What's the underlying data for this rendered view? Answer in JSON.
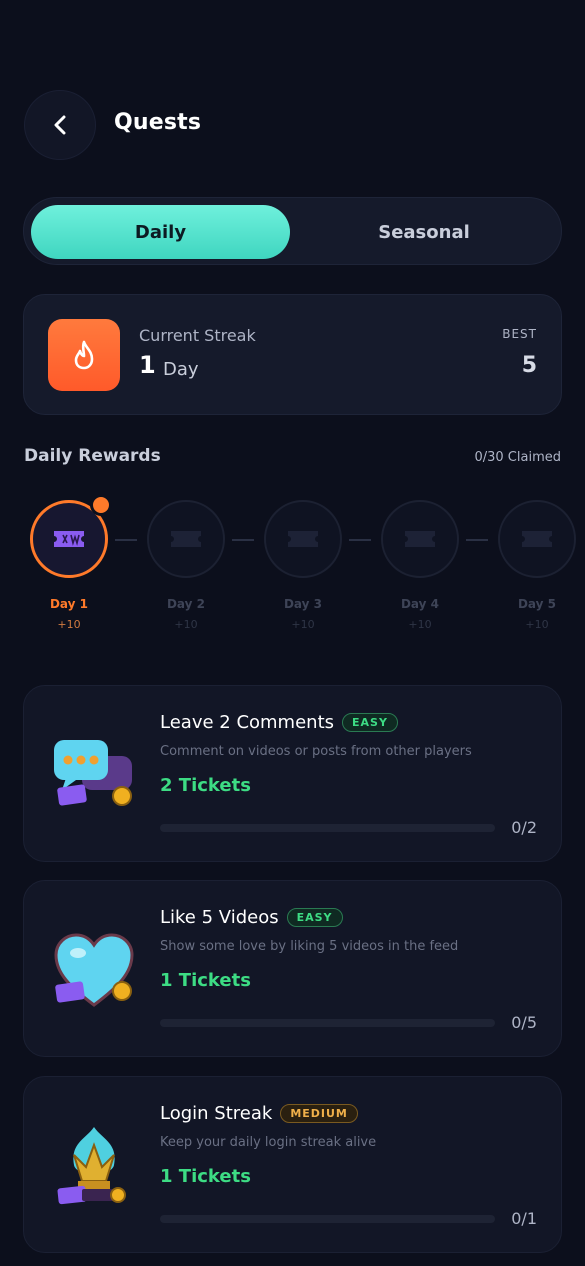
{
  "header": {
    "title": "Quests"
  },
  "tabs": [
    {
      "label": "Daily",
      "active": true
    },
    {
      "label": "Seasonal",
      "active": false
    }
  ],
  "streak": {
    "label": "Current Streak",
    "value": "1",
    "unit": "Day",
    "best_label": "BEST",
    "best_value": "5",
    "icon": "flame-icon",
    "color": "#ff6a30"
  },
  "rewards": {
    "title": "Daily Rewards",
    "claimed": "0/30 Claimed",
    "days": [
      {
        "label": "Day 1",
        "reward": "+10",
        "active": true
      },
      {
        "label": "Day 2",
        "reward": "+10",
        "active": false
      },
      {
        "label": "Day 3",
        "reward": "+10",
        "active": false
      },
      {
        "label": "Day 4",
        "reward": "+10",
        "active": false
      },
      {
        "label": "Day 5",
        "reward": "+10",
        "active": false
      }
    ],
    "icon": "ticket-icon",
    "accent": "#ff7a2a"
  },
  "quests": [
    {
      "title": "Leave 2 Comments",
      "difficulty": "EASY",
      "description": "Comment on videos or posts from other players",
      "reward": "2 Tickets",
      "progress": "0/2",
      "progress_fraction": 0,
      "icon": "chat-bubble-icon"
    },
    {
      "title": "Like 5 Videos",
      "difficulty": "EASY",
      "description": "Show some love by liking 5 videos in the feed",
      "reward": "1 Tickets",
      "progress": "0/5",
      "progress_fraction": 0,
      "icon": "heart-icon"
    },
    {
      "title": "Login Streak",
      "difficulty": "MEDIUM",
      "description": "Keep your daily login streak alive",
      "reward": "1 Tickets",
      "progress": "0/1",
      "progress_fraction": 0,
      "icon": "crown-flame-icon"
    }
  ],
  "colors": {
    "background": "#0c0f1c",
    "active_tab": "#4fe3cc",
    "reward_green": "#3ddc84",
    "easy": "#3ddc84",
    "medium": "#f0b04a"
  }
}
